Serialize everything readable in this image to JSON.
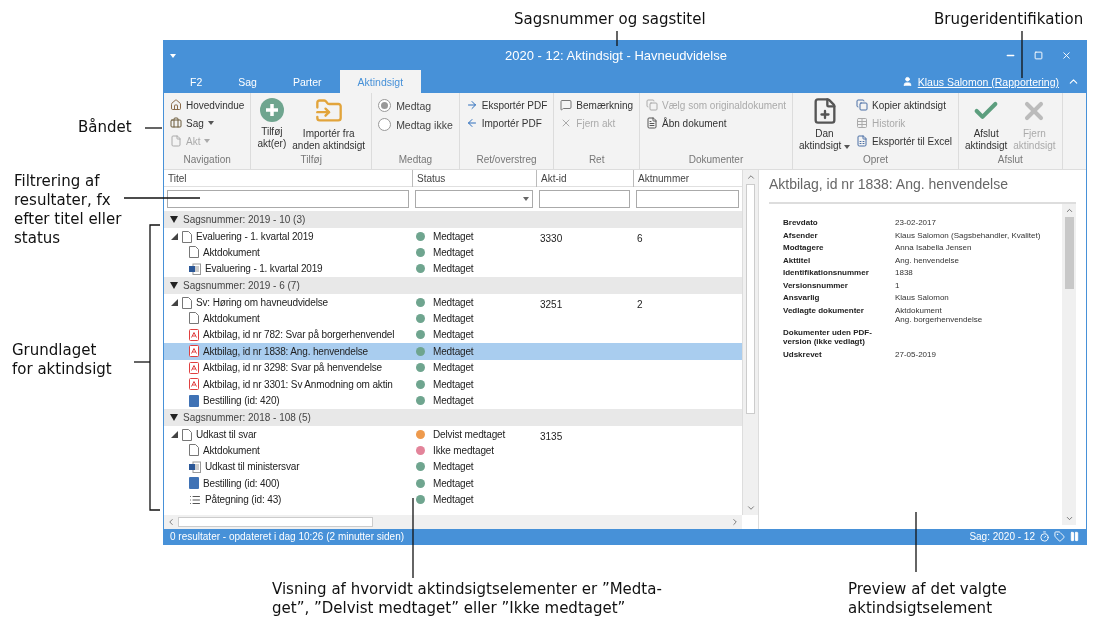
{
  "annotations": [
    {
      "lines": [
        "Sagsnummer og sagstitel"
      ]
    },
    {
      "lines": [
        "Brugeridentifikation"
      ]
    },
    {
      "lines": [
        "Båndet"
      ]
    },
    {
      "lines": [
        "Filtrering af",
        "resultater, fx",
        "efter titel eller",
        "status"
      ]
    },
    {
      "lines": [
        "Grundlaget",
        "for aktindsigt"
      ]
    },
    {
      "lines": [
        "Visning af hvorvidt aktindsigtselementer er ”Medta-",
        "get”, ”Delvist medtaget” eller ”Ikke medtaget”"
      ]
    },
    {
      "lines": [
        "Preview af det valgte",
        "aktindsigtselement"
      ]
    }
  ],
  "window": {
    "title": "2020 - 12: Aktindsigt - Havneudvidelse"
  },
  "tabs": [
    {
      "label": "F2",
      "selected": false
    },
    {
      "label": "Sag",
      "selected": false
    },
    {
      "label": "Parter",
      "selected": false
    },
    {
      "label": "Aktindsigt",
      "selected": true
    }
  ],
  "user": {
    "name": "Klaus Salomon (Rapportering)"
  },
  "ribbon": [
    {
      "label": "Navigation",
      "items": [
        {
          "kind": "small",
          "label": "Hovedvindue",
          "dropdown": false,
          "disabled": false
        },
        {
          "kind": "small",
          "label": "Sag",
          "dropdown": true,
          "disabled": false
        },
        {
          "kind": "small",
          "label": "Akt",
          "dropdown": true,
          "disabled": true
        }
      ]
    },
    {
      "label": "Tilføj",
      "items": [
        {
          "kind": "large",
          "lines": [
            "Tilføj",
            "akt(er)"
          ],
          "dropdown": false,
          "disabled": false
        },
        {
          "kind": "large",
          "lines": [
            "Importér fra",
            "anden aktindsigt"
          ],
          "dropdown": false,
          "disabled": false
        }
      ]
    },
    {
      "label": "Medtag",
      "items": [
        {
          "kind": "radio",
          "label": "Medtag",
          "selected": true
        },
        {
          "kind": "radio",
          "label": "Medtag ikke",
          "selected": false
        }
      ]
    },
    {
      "label": "Ret/overstreg",
      "items": [
        {
          "kind": "small",
          "label": "Eksportér PDF",
          "dropdown": false,
          "disabled": false
        },
        {
          "kind": "small",
          "label": "Importér PDF",
          "dropdown": false,
          "disabled": false
        }
      ]
    },
    {
      "label": "Ret",
      "items": [
        {
          "kind": "small",
          "label": "Bemærkning",
          "dropdown": false,
          "disabled": false
        },
        {
          "kind": "small",
          "label": "Fjern akt",
          "dropdown": false,
          "disabled": true
        }
      ]
    },
    {
      "label": "Dokumenter",
      "items": [
        {
          "kind": "small",
          "label": "Vælg som originaldokument",
          "dropdown": false,
          "disabled": true
        },
        {
          "kind": "small",
          "label": "Åbn dokument",
          "dropdown": false,
          "disabled": false
        }
      ]
    },
    {
      "label": "Opret",
      "items": [
        {
          "kind": "large",
          "lines": [
            "Dan",
            "aktindsigt"
          ],
          "dropdown": true,
          "disabled": false
        },
        {
          "kind": "small",
          "label": "Kopier aktindsigt",
          "dropdown": false,
          "disabled": false
        },
        {
          "kind": "small",
          "label": "Historik",
          "dropdown": false,
          "disabled": true
        },
        {
          "kind": "small",
          "label": "Eksportér til Excel",
          "dropdown": false,
          "disabled": false
        }
      ]
    },
    {
      "label": "Afslut",
      "items": [
        {
          "kind": "large",
          "lines": [
            "Afslut",
            "aktindsigt"
          ],
          "dropdown": false,
          "disabled": false
        },
        {
          "kind": "large",
          "lines": [
            "Fjern",
            "aktindsigt"
          ],
          "dropdown": false,
          "disabled": true
        }
      ]
    }
  ],
  "grid": {
    "columns": [
      "Titel",
      "Status",
      "Akt-id",
      "Aktnummer"
    ],
    "filters": [
      {
        "kind": "text"
      },
      {
        "kind": "select"
      },
      {
        "kind": "text"
      },
      {
        "kind": "text"
      }
    ],
    "groups": [
      {
        "title": "Sagsnummer: 2019 - 10 (3)",
        "expanded": true,
        "rows": [
          {
            "kind": "doc",
            "title": "Evaluering - 1. kvartal 2019",
            "status": "Medtaget",
            "color": "#6fa58f",
            "akt_id": "3330",
            "aktnummer": "6",
            "selected": false,
            "expanded": true,
            "children": [
              {
                "kind": "doc",
                "title": "Aktdokument",
                "status": "Medtaget",
                "color": "#6fa58f",
                "selected": false
              },
              {
                "kind": "word",
                "title": "Evaluering - 1. kvartal 2019",
                "status": "Medtaget",
                "color": "#6fa58f",
                "selected": false
              }
            ]
          }
        ]
      },
      {
        "title": "Sagsnummer: 2019 - 6 (7)",
        "expanded": true,
        "rows": [
          {
            "kind": "doc",
            "title": "Sv: Høring om havneudvidelse",
            "status": "Medtaget",
            "color": "#6fa58f",
            "akt_id": "3251",
            "aktnummer": "2",
            "selected": false,
            "expanded": true,
            "children": [
              {
                "kind": "doc",
                "title": "Aktdokument",
                "status": "Medtaget",
                "color": "#6fa58f",
                "selected": false
              },
              {
                "kind": "pdf",
                "title": "Aktbilag, id nr 782: Svar på borgerhenvendel",
                "status": "Medtaget",
                "color": "#6fa58f",
                "selected": false
              },
              {
                "kind": "pdf",
                "title": "Aktbilag, id nr 1838: Ang. henvendelse",
                "status": "Medtaget",
                "color": "#6fa58f",
                "selected": true
              },
              {
                "kind": "pdf",
                "title": "Aktbilag, id nr 3298: Svar på henvendelse",
                "status": "Medtaget",
                "color": "#6fa58f",
                "selected": false
              },
              {
                "kind": "pdf",
                "title": "Aktbilag, id nr 3301: Sv Anmodning om aktin",
                "status": "Medtaget",
                "color": "#6fa58f",
                "selected": false
              },
              {
                "kind": "book",
                "title": "Bestilling (id: 420)",
                "status": "Medtaget",
                "color": "#6fa58f",
                "selected": false
              }
            ]
          }
        ]
      },
      {
        "title": "Sagsnummer: 2018 - 108 (5)",
        "expanded": true,
        "rows": [
          {
            "kind": "doc",
            "title": "Udkast til svar",
            "status": "Delvist medtaget",
            "color": "#ee9a4d",
            "akt_id": "3135",
            "selected": false,
            "expanded": true,
            "children": [
              {
                "kind": "doc",
                "title": "Aktdokument",
                "status": "Ikke medtaget",
                "color": "#e3849a",
                "selected": false
              },
              {
                "kind": "word",
                "title": "Udkast til ministersvar",
                "status": "Medtaget",
                "color": "#6fa58f",
                "selected": false
              },
              {
                "kind": "book",
                "title": "Bestilling (id: 400)",
                "status": "Medtaget",
                "color": "#6fa58f",
                "selected": false
              },
              {
                "kind": "list",
                "title": "Påtegning (id: 43)",
                "status": "Medtaget",
                "color": "#6fa58f",
                "selected": false
              }
            ]
          }
        ]
      }
    ]
  },
  "preview": {
    "title": "Aktbilag, id nr 1838: Ang. henvendelse",
    "fields": [
      {
        "label": "Brevdato",
        "values": [
          "23-02-2017"
        ]
      },
      {
        "label": "Afsender",
        "values": [
          "Klaus Salomon (Sagsbehandler, Kvalitet)"
        ]
      },
      {
        "label": "Modtagere",
        "values": [
          "Anna Isabella Jensen"
        ]
      },
      {
        "label": "Akttitel",
        "values": [
          "Ang. henvendelse"
        ]
      },
      {
        "label": "Identifikationsnummer",
        "values": [
          "1838"
        ]
      },
      {
        "label": "Versionsnummer",
        "values": [
          "1"
        ]
      },
      {
        "label": "Ansvarlig",
        "values": [
          "Klaus Salomon"
        ]
      },
      {
        "label": "Vedlagte dokumenter",
        "values": [
          "Aktdokument",
          "Ang. borgerhenvendelse"
        ]
      },
      {
        "label": "Dokumenter uden PDF-version (ikke vedlagt)"
      },
      {
        "label": "Udskrevet",
        "values": [
          "27-05-2019"
        ]
      }
    ]
  },
  "status_bar": {
    "left": "0 resultater - opdateret i dag 10:26 (2 minutter siden)",
    "right": "Sag: 2020 - 12"
  }
}
